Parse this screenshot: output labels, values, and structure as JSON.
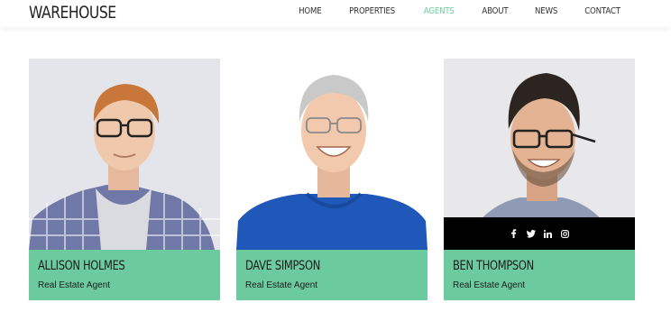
{
  "brand": "WAREHOUSE",
  "nav": [
    "HOME",
    "PROPERTIES",
    "AGENTS",
    "ABOUT",
    "NEWS",
    "CONTACT"
  ],
  "nav_active": "AGENTS",
  "colors": {
    "accent": "#6cd0a0",
    "card_info_bg": "#6cca9f",
    "social_bar_bg": "#000000"
  },
  "agents": [
    {
      "name": "ALLISON HOLMES",
      "role": "Real Estate Agent"
    },
    {
      "name": "DAVE SIMPSON",
      "role": "Real Estate Agent"
    },
    {
      "name": "BEN THOMPSON",
      "role": "Real Estate Agent"
    }
  ],
  "social_icons": [
    "facebook-icon",
    "twitter-icon",
    "linkedin-icon",
    "instagram-icon"
  ]
}
